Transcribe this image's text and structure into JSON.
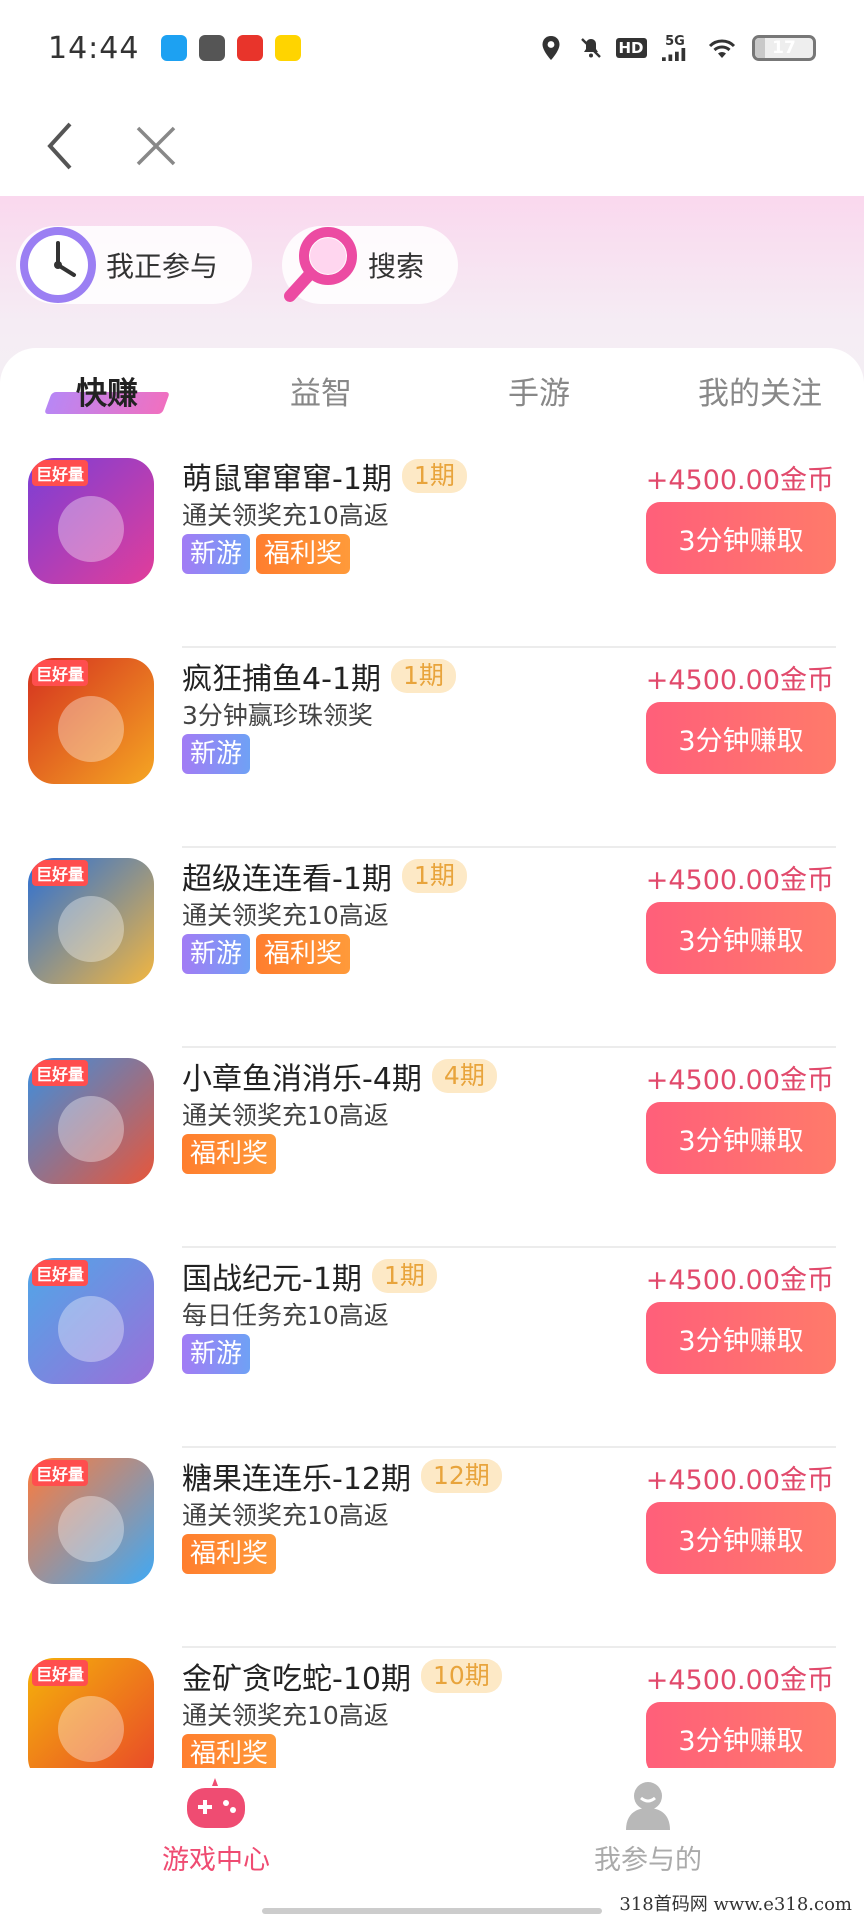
{
  "status_bar": {
    "time": "14:44",
    "apps": [
      "qq-icon",
      "wechat-icon",
      "pdd-icon",
      "meituan-icon"
    ],
    "app_colors": [
      "#1da1f2",
      "#555555",
      "#e8342b",
      "#ffd400"
    ],
    "battery_level": "17",
    "battery_fraction": 0.17,
    "network": "5G",
    "hd": "HD"
  },
  "nav": {
    "back_icon": "chevron-left-icon",
    "close_icon": "close-icon"
  },
  "header": {
    "participating_label": "我正参与",
    "search_label": "搜索"
  },
  "tabs": [
    {
      "label": "快赚",
      "active": true
    },
    {
      "label": "益智",
      "active": false
    },
    {
      "label": "手游",
      "active": false
    },
    {
      "label": "我的关注",
      "active": false
    }
  ],
  "games": [
    {
      "title": "萌鼠窜窜窜-1期",
      "period": "1期",
      "desc": "通关领奖充10高返",
      "badges": [
        "新游",
        "福利奖"
      ],
      "reward": "+4500.00金币",
      "button": "3分钟赚取",
      "icon_tag": "巨好量",
      "icon_colors": [
        "#7a3fd6",
        "#e23d9a"
      ]
    },
    {
      "title": "疯狂捕鱼4-1期",
      "period": "1期",
      "desc": "3分钟赢珍珠领奖",
      "badges": [
        "新游"
      ],
      "reward": "+4500.00金币",
      "button": "3分钟赚取",
      "icon_tag": "巨好量",
      "icon_colors": [
        "#d4301f",
        "#f5a623"
      ]
    },
    {
      "title": "超级连连看-1期",
      "period": "1期",
      "desc": "通关领奖充10高返",
      "badges": [
        "新游",
        "福利奖"
      ],
      "reward": "+4500.00金币",
      "button": "3分钟赚取",
      "icon_tag": "巨好量",
      "icon_colors": [
        "#2a6fd6",
        "#f2b640"
      ]
    },
    {
      "title": "小章鱼消消乐-4期",
      "period": "4期",
      "desc": "通关领奖充10高返",
      "badges": [
        "福利奖"
      ],
      "reward": "+4500.00金币",
      "button": "3分钟赚取",
      "icon_tag": "巨好量",
      "icon_colors": [
        "#3b8fe0",
        "#e8563a"
      ]
    },
    {
      "title": "国战纪元-1期",
      "period": "1期",
      "desc": "每日任务充10高返",
      "badges": [
        "新游"
      ],
      "reward": "+4500.00金币",
      "button": "3分钟赚取",
      "icon_tag": "巨好量",
      "icon_colors": [
        "#4fa7e8",
        "#9b6fd9"
      ]
    },
    {
      "title": "糖果连连乐-12期",
      "period": "12期",
      "desc": "通关领奖充10高返",
      "badges": [
        "福利奖"
      ],
      "reward": "+4500.00金币",
      "button": "3分钟赚取",
      "icon_tag": "巨好量",
      "icon_colors": [
        "#ff7a3a",
        "#3fa9f5"
      ]
    },
    {
      "title": "金矿贪吃蛇-10期",
      "period": "10期",
      "desc": "通关领奖充10高返",
      "badges": [
        "福利奖"
      ],
      "reward": "+4500.00金币",
      "button": "3分钟赚取",
      "icon_tag": "巨好量",
      "icon_colors": [
        "#f5b20a",
        "#e8452a"
      ]
    }
  ],
  "bottom_tabs": [
    {
      "label": "游戏中心",
      "icon": "gamepad-icon",
      "active": true,
      "color": "#ef4c72"
    },
    {
      "label": "我参与的",
      "icon": "user-icon",
      "active": false,
      "color": "#aaaaaa"
    }
  ],
  "watermark": "318首码网 www.e318.com"
}
